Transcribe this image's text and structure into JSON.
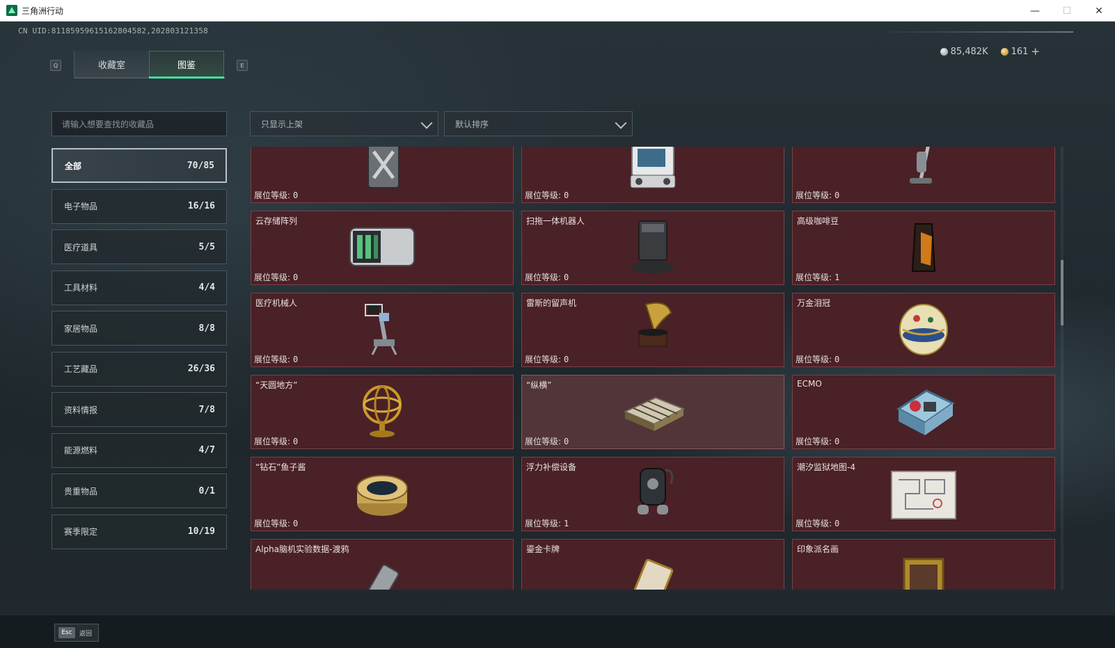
{
  "window": {
    "title": "三角洲行动",
    "minimize": "—",
    "maximize": "☐",
    "close": "✕"
  },
  "header": {
    "uid": "CN UID:8118595961516280458​2,202803121358",
    "tabs": [
      {
        "label": "收藏室"
      },
      {
        "label": "图鉴"
      }
    ],
    "key_left": "Q",
    "key_right": "E",
    "currency": {
      "silver": "85,482K",
      "gold": "161",
      "add": "+"
    }
  },
  "search": {
    "placeholder": "请输入想要查找的收藏品"
  },
  "filters": {
    "shelf": "只显示上架",
    "sort": "默认排序"
  },
  "categories": [
    {
      "label": "全部",
      "count": "70/85",
      "active": true
    },
    {
      "label": "电子物品",
      "count": "16/16"
    },
    {
      "label": "医疗道具",
      "count": "5/5"
    },
    {
      "label": "工具材料",
      "count": "4/4"
    },
    {
      "label": "家居物品",
      "count": "8/8"
    },
    {
      "label": "工艺藏品",
      "count": "26/36"
    },
    {
      "label": "资料情报",
      "count": "7/8"
    },
    {
      "label": "能源燃料",
      "count": "4/7"
    },
    {
      "label": "贵重物品",
      "count": "0/1"
    },
    {
      "label": "赛季限定",
      "count": "10/19"
    }
  ],
  "level_label": "展位等级:",
  "items": [
    {
      "name": "",
      "level": "0",
      "icon": "jerrycan-icon"
    },
    {
      "name": "",
      "level": "0",
      "icon": "medical-monitor-icon"
    },
    {
      "name": "",
      "level": "0",
      "icon": "floor-washer-icon"
    },
    {
      "name": "云存储阵列",
      "level": "0",
      "icon": "storage-array-icon"
    },
    {
      "name": "扫拖一体机器人",
      "level": "0",
      "icon": "robot-vacuum-icon"
    },
    {
      "name": "高级咖啡豆",
      "level": "1",
      "icon": "coffee-bag-icon"
    },
    {
      "name": "医疗机械人",
      "level": "0",
      "icon": "medical-robot-icon"
    },
    {
      "name": "雷斯的留声机",
      "level": "0",
      "icon": "gramophone-icon"
    },
    {
      "name": "万金泪冠",
      "level": "0",
      "icon": "jeweled-egg-icon"
    },
    {
      "name": "“天圆地方”",
      "level": "0",
      "icon": "armillary-sphere-icon"
    },
    {
      "name": "“纵横”",
      "level": "0",
      "icon": "chess-box-icon",
      "selected": true
    },
    {
      "name": "ECMO",
      "level": "0",
      "icon": "ecmo-machine-icon"
    },
    {
      "name": "“钻石”鱼子酱",
      "level": "0",
      "icon": "caviar-tin-icon"
    },
    {
      "name": "浮力补偿设备",
      "level": "1",
      "icon": "bcd-vest-icon"
    },
    {
      "name": "潮汐监狱地图-4",
      "level": "0",
      "icon": "prison-map-icon"
    },
    {
      "name": "Alpha脑机实验数据-渡鸦",
      "level": "",
      "icon": "data-cylinder-icon"
    },
    {
      "name": "鎏金卡牌",
      "level": "",
      "icon": "gilded-card-icon"
    },
    {
      "name": "印象派名画",
      "level": "",
      "icon": "framed-painting-icon"
    }
  ],
  "footer": {
    "esc_key": "Esc",
    "back_label": "返回"
  },
  "colors": {
    "accent": "#3fe0a0",
    "card_bg": "#4a2126",
    "card_border": "#7a4146"
  }
}
